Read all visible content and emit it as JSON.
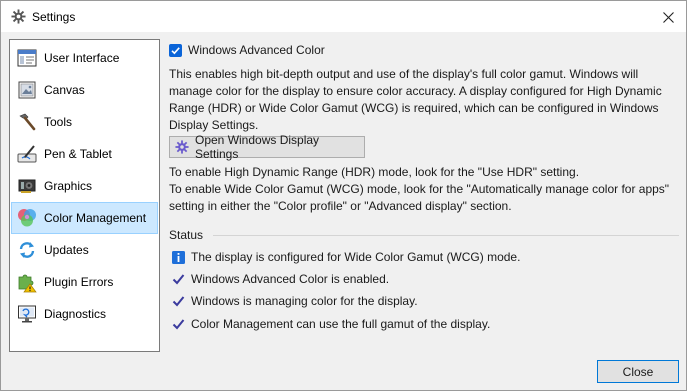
{
  "window": {
    "title": "Settings",
    "icon": "gear-icon",
    "close_icon": "close-icon"
  },
  "sidebar": {
    "items": [
      {
        "label": "User Interface",
        "icon": "user-interface-icon",
        "selected": false
      },
      {
        "label": "Canvas",
        "icon": "canvas-icon",
        "selected": false
      },
      {
        "label": "Tools",
        "icon": "tools-icon",
        "selected": false
      },
      {
        "label": "Pen & Tablet",
        "icon": "pen-tablet-icon",
        "selected": false
      },
      {
        "label": "Graphics",
        "icon": "graphics-icon",
        "selected": false
      },
      {
        "label": "Color Management",
        "icon": "color-management-icon",
        "selected": true
      },
      {
        "label": "Updates",
        "icon": "updates-icon",
        "selected": false
      },
      {
        "label": "Plugin Errors",
        "icon": "plugin-errors-icon",
        "selected": false
      },
      {
        "label": "Diagnostics",
        "icon": "diagnostics-icon",
        "selected": false
      }
    ]
  },
  "main": {
    "checkbox": {
      "label": "Windows Advanced Color",
      "checked": true
    },
    "description_lines": [
      "This enables high bit-depth output and use of the display's full color gamut. Windows will",
      "manage color for the display to ensure color accuracy. A display configured for High Dynamic",
      "Range (HDR) or Wide Color Gamut (WCG) is required, which can be configured in Windows",
      "Display Settings."
    ],
    "open_settings_button": "Open Windows Display Settings",
    "hint_lines": [
      "To enable High Dynamic Range (HDR) mode, look for the \"Use HDR\" setting.",
      "To enable Wide Color Gamut (WCG) mode, look for the \"Automatically manage color for apps\"",
      "setting in either the \"Color profile\" or \"Advanced display\" section."
    ],
    "status": {
      "heading": "Status",
      "items": [
        {
          "icon": "info-icon",
          "text": "The display is configured for Wide Color Gamut (WCG) mode."
        },
        {
          "icon": "checkmark-icon",
          "text": "Windows Advanced Color is enabled."
        },
        {
          "icon": "checkmark-icon",
          "text": "Windows is managing color for the display."
        },
        {
          "icon": "checkmark-icon",
          "text": "Color Management can use the full gamut of the display."
        }
      ]
    }
  },
  "footer": {
    "close_button": "Close"
  },
  "colors": {
    "accent": "#0a64d8",
    "selection": "#cce8ff",
    "check": "#3b3b9e",
    "info": "#1e6fd9"
  }
}
